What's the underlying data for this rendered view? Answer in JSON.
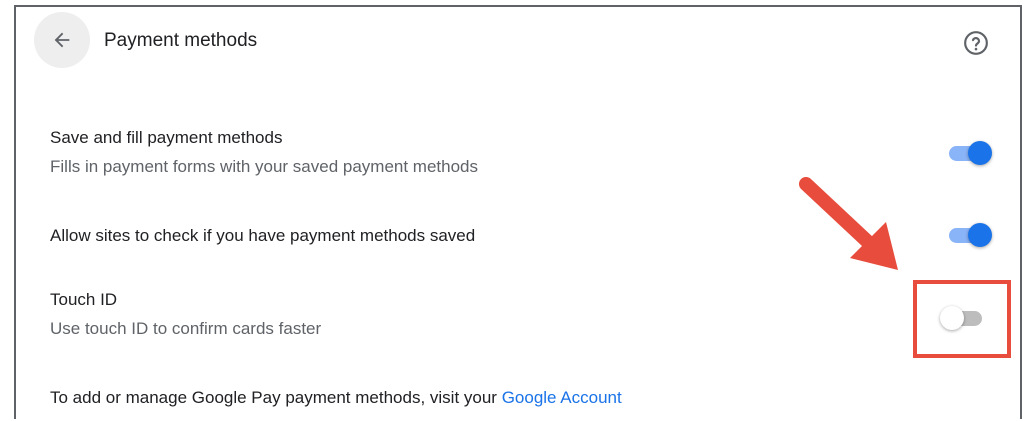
{
  "header": {
    "title": "Payment methods",
    "back_icon": "arrow-left-icon",
    "help_icon": "help-circle-icon"
  },
  "settings": [
    {
      "title": "Save and fill payment methods",
      "subtitle": "Fills in payment forms with your saved payment methods",
      "enabled": true
    },
    {
      "title": "Allow sites to check if you have payment methods saved",
      "enabled": true
    },
    {
      "title": "Touch ID",
      "subtitle": "Use touch ID to confirm cards faster",
      "enabled": false
    }
  ],
  "footer": {
    "text": "To add or manage Google Pay payment methods, visit your ",
    "link": "Google Account"
  },
  "colors": {
    "accent": "#1a73e8",
    "annotation": "#e74c3c"
  }
}
